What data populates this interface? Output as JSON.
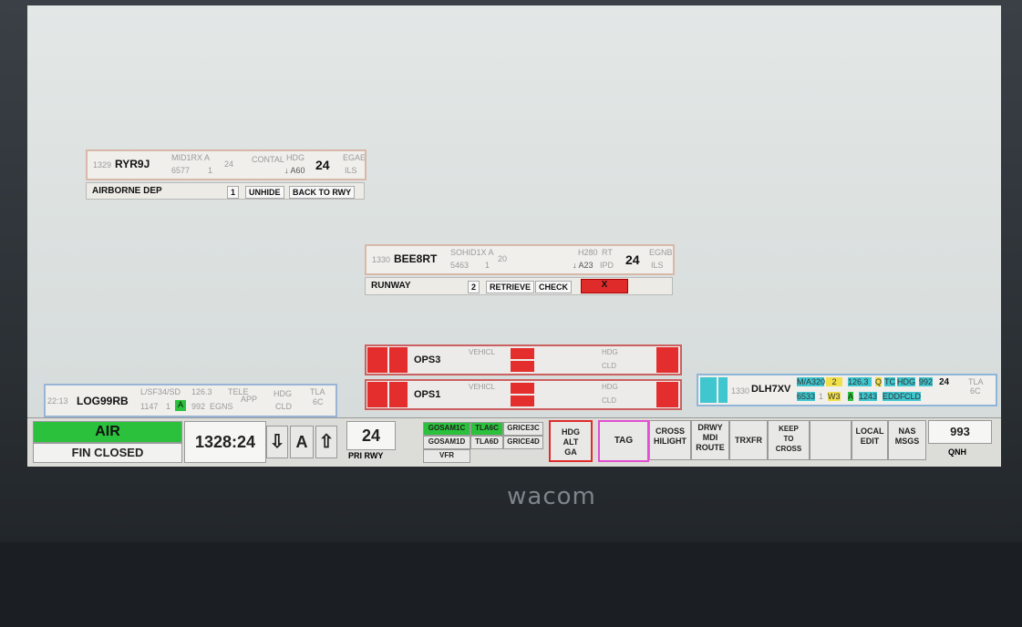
{
  "device": {
    "brand": "wacom"
  },
  "strip_ryr": {
    "time": "1329",
    "callsign": "RYR9J",
    "sid": "MID1RX A",
    "ssr": "6577",
    "alt_num": "1",
    "rfl": "24",
    "runway": "24",
    "route": "CONTAL",
    "hdg": "HDG",
    "alt": "↓ A60",
    "dest": "EGAE",
    "app": "ILS"
  },
  "airborne_bar": {
    "label": "AIRBORNE DEP",
    "count": "1",
    "unhide": "UNHIDE",
    "back": "BACK TO RWY"
  },
  "strip_bee": {
    "time": "1330",
    "callsign": "BEE8RT",
    "sid": "SOHID1X A",
    "ssr": "5463",
    "alt_num": "1",
    "rfl": "20",
    "hdg": "H280",
    "rt": "RT",
    "alt": "↓ A23",
    "ipd": "IPD",
    "runway": "24",
    "dest": "EGNB",
    "app": "ILS"
  },
  "runway_bar": {
    "label": "RUNWAY",
    "count": "2",
    "retrieve": "RETRIEVE",
    "check": "CHECK",
    "x": "X"
  },
  "vehicles": [
    {
      "name": "OPS3",
      "type": "VEHICL",
      "hdg": "HDG",
      "cld": "CLD"
    },
    {
      "name": "OPS1",
      "type": "VEHICL",
      "hdg": "HDG",
      "cld": "CLD"
    }
  ],
  "strip_log": {
    "time": "22:13",
    "callsign": "LOG99RB",
    "type": "L/SF34/SD",
    "freq": "126.3",
    "tele": "TELE",
    "ssr": "1147",
    "alt_num": "1",
    "ab": "A",
    "qnh": "992",
    "dest": "EGNS",
    "app": "APP",
    "hdg": "HDG",
    "cld": "CLD",
    "tla": "TLA",
    "tla2": "6C"
  },
  "strip_dlh": {
    "time": "1330",
    "callsign": "DLH7XV",
    "type": "M/A320",
    "w": "2",
    "freq": "126.3",
    "q": "Q",
    "tc": "TC",
    "hdg": "HDG",
    "qnh": "992",
    "rwy": "24",
    "tla": "TLA",
    "tla2": "6C",
    "ssr": "6533",
    "num": "1",
    "wake": "W3",
    "a": "A",
    "sq": "1243",
    "dest": "EDDF",
    "cld": "CLD"
  },
  "bottom": {
    "air": "AIR",
    "fin": "FIN CLOSED",
    "clock": "1328:24",
    "down": "⇩",
    "mode": "A",
    "up": "⇧",
    "rwy": "24",
    "pri": "PRI RWY",
    "gosam1c": "GOSAM1C",
    "tla6c": "TLA6C",
    "grice3c": "GRICE3C",
    "gosam1d": "GOSAM1D",
    "tla6d": "TLA6D",
    "grice4d": "GRICE4D",
    "vfr": "VFR",
    "hdg1": "HDG",
    "hdg2": "ALT",
    "hdg3": "GA",
    "tag": "TAG",
    "cross1": "CROSS",
    "cross2": "HILIGHT",
    "drwy1": "DRWY",
    "drwy2": "MDI",
    "drwy3": "ROUTE",
    "trxfr": "TRXFR",
    "keep1": "KEEP",
    "keep2": "TO",
    "keep3": "CROSS",
    "local1": "LOCAL",
    "local2": "EDIT",
    "nas1": "NAS",
    "nas2": "MSGS",
    "qnh_val": "993",
    "qnh_lbl": "QNH"
  },
  "colors": {
    "green": "#2bc13c",
    "red": "#e02b2b",
    "cyan": "#3fc6cf",
    "yellow": "#f0e04a",
    "magenta": "#e24fd0"
  }
}
